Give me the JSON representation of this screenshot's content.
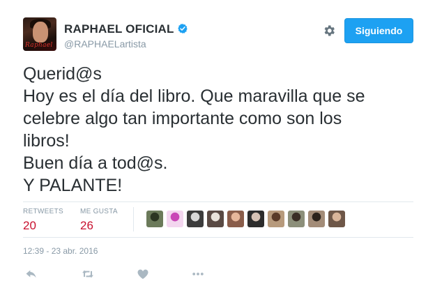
{
  "header": {
    "display_name": "RAPHAEL OFICIAL",
    "handle": "@RAPHAELartista",
    "avatar_signature": "Raphael",
    "follow_button_label": "Siguiendo"
  },
  "tweet": {
    "lines": [
      "Querid@s",
      "Hoy es el día del libro. Que maravilla que se",
      "celebre algo tan importante como son los",
      "libros!",
      "Buen día a tod@s.",
      "Y PALANTE!"
    ]
  },
  "stats": {
    "retweets_label": "RETWEETS",
    "retweets_count": "20",
    "likes_label": "ME GUSTA",
    "likes_count": "26"
  },
  "liker_avatars": [
    {
      "color": "#6b7a5a",
      "accent": "#2b3522"
    },
    {
      "color": "#f3d6ef",
      "accent": "#c946b6"
    },
    {
      "color": "#3c3c3c",
      "accent": "#d8d8d8"
    },
    {
      "color": "#5a4a44",
      "accent": "#e9e2da"
    },
    {
      "color": "#8a5d4a",
      "accent": "#e7b79b"
    },
    {
      "color": "#2c2c2c",
      "accent": "#d6c2b5"
    },
    {
      "color": "#b79a7c",
      "accent": "#5a3b28"
    },
    {
      "color": "#8c8f7a",
      "accent": "#3a2e26"
    },
    {
      "color": "#a38c78",
      "accent": "#2c231c"
    },
    {
      "color": "#6e5748",
      "accent": "#d9b59a"
    }
  ],
  "timestamp": "12:39 - 23 abr. 2016",
  "colors": {
    "accent_blue": "#1da1f2",
    "count_red": "#c8102e",
    "muted_gray": "#8899a6",
    "action_gray": "#aab8c2"
  },
  "icons": {
    "verified": "verified-badge-icon",
    "settings": "gear-icon",
    "reply": "reply-icon",
    "retweet": "retweet-icon",
    "like": "heart-icon",
    "more": "more-dots-icon"
  }
}
